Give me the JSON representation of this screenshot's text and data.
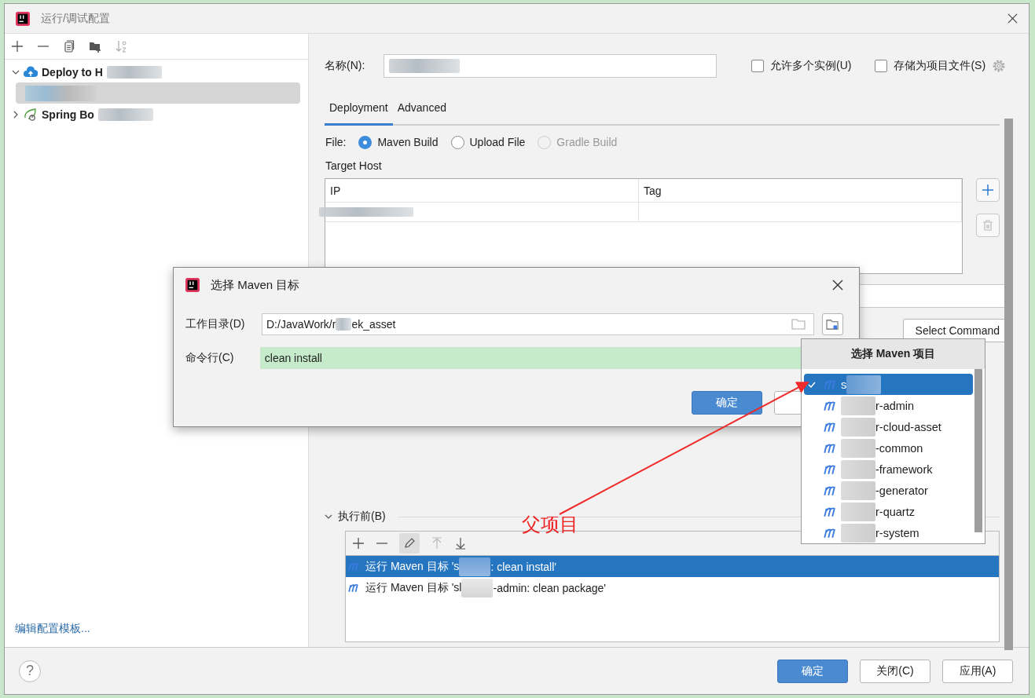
{
  "window": {
    "title": "运行/调试配置"
  },
  "tree": [
    {
      "label": "Deploy to H",
      "kind": "deploy",
      "expanded": true,
      "children": [
        {
          "selected": true
        }
      ]
    },
    {
      "label": "Spring Bo",
      "kind": "spring",
      "expanded": false
    }
  ],
  "edit_templates_link": "编辑配置模板...",
  "name_field": {
    "label": "名称(N):"
  },
  "options": [
    {
      "label": "允许多个实例(U)",
      "checked": false
    },
    {
      "label": "存储为项目文件(S)",
      "checked": false
    }
  ],
  "tabs": [
    {
      "label": "Deployment",
      "selected": true
    },
    {
      "label": "Advanced",
      "selected": false
    }
  ],
  "file": {
    "label": "File:",
    "options": [
      {
        "label": "Maven Build",
        "selected": true,
        "disabled": false
      },
      {
        "label": "Upload File",
        "selected": false,
        "disabled": false
      },
      {
        "label": "Gradle Build",
        "selected": false,
        "disabled": true
      }
    ]
  },
  "target_host": {
    "label": "Target Host",
    "columns": [
      "IP",
      "Tag"
    ]
  },
  "select_command_button": "Select Command",
  "before_launch": {
    "label": "执行前(B)",
    "expanded": true,
    "tasks": [
      {
        "before": "运行 Maven 目标 's",
        "after": ": clean install'",
        "selected": true
      },
      {
        "before": "运行 Maven 目标 'sl",
        "after": "-admin: clean package'",
        "selected": false
      }
    ]
  },
  "help": "?",
  "buttons": [
    {
      "label": "确定",
      "primary": true
    },
    {
      "label": "关闭(C)",
      "primary": false
    },
    {
      "label": "应用(A)",
      "primary": false
    }
  ],
  "goal_dialog": {
    "title": "选择 Maven 目标",
    "fields": [
      {
        "label": "工作目录(D)",
        "kind": "path",
        "before": "D:/JavaWork/r",
        "after": "ek_asset"
      },
      {
        "label": "命令行(C)",
        "kind": "command",
        "before": "clean install"
      }
    ],
    "ok_button": "确定"
  },
  "project_popup": {
    "title": "选择 Maven 项目",
    "items": [
      {
        "before": "s",
        "selected": true
      },
      {
        "after": "r-admin",
        "selected": false
      },
      {
        "after": "r-cloud-asset",
        "selected": false
      },
      {
        "after": "-common",
        "selected": false
      },
      {
        "after": "-framework",
        "selected": false
      },
      {
        "after": "-generator",
        "selected": false
      },
      {
        "after": "r-quartz",
        "selected": false
      },
      {
        "after": "r-system",
        "selected": false
      }
    ]
  },
  "annotation": {
    "text": "父项目"
  }
}
